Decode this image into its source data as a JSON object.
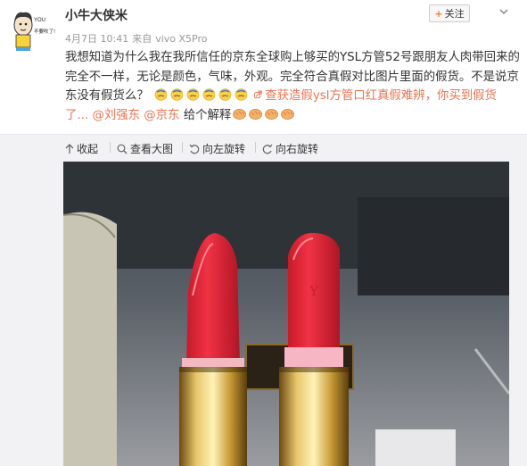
{
  "user": {
    "name": "小牛大侠米",
    "avatar_text_1": "YOU",
    "avatar_text_2": "不要吹了!"
  },
  "follow": {
    "plus": "+",
    "label": "关注"
  },
  "meta": {
    "date": "4月7日 10:41",
    "source_prefix": "来自",
    "source": "vivo X5Pro"
  },
  "post": {
    "text": "我想知道为什么我在我所信任的京东全球购上够买的YSL方管52号跟朋友人肉带回来的完全不一样，无论是颜色，气味，外观。完全符合真假对比图片里面的假货。不是说京东没有假货么？",
    "link_text": "查获造假ysl方管口红真假难辨，你买到假货了...",
    "mention_1": "@刘强东",
    "mention_2": "@京东",
    "ending": "给个解释"
  },
  "toolbar": {
    "collapse": "收起",
    "view_large": "查看大图",
    "rotate_left": "向左旋转",
    "rotate_right": "向右旋转"
  },
  "colors": {
    "accent": "#eb7350",
    "follow_plus": "#f77c3d",
    "toolbar_bg": "#f2f2f5"
  },
  "icons": [
    "sweat-emoji-icon",
    "clap-emoji-icon",
    "link-icon",
    "chevron-down-icon"
  ]
}
